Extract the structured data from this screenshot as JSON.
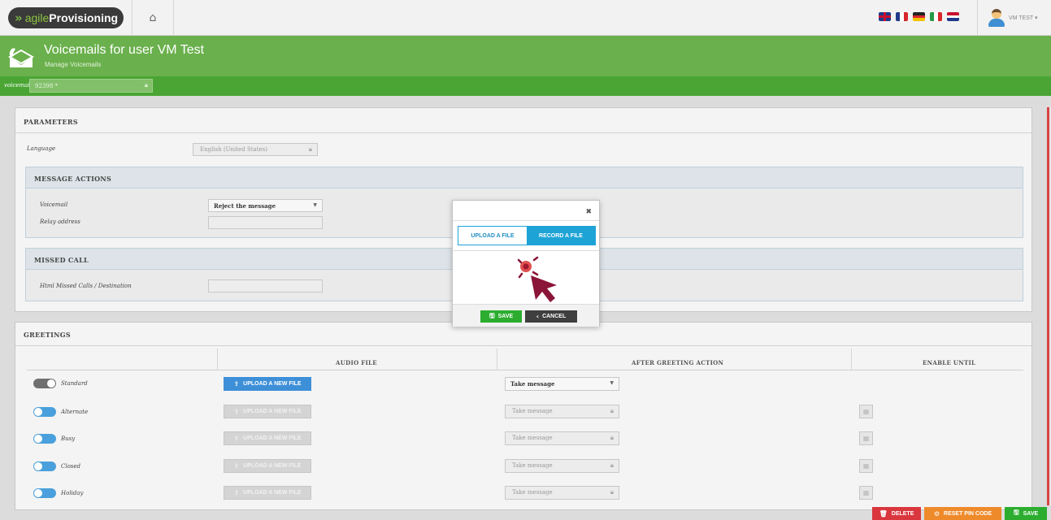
{
  "topbar": {
    "logo_light": "agile",
    "logo_bold": "Provisioning",
    "home_icon": "home-icon",
    "languages": [
      "English (UK)",
      "French",
      "German",
      "Italian",
      "Dutch"
    ],
    "user_name": "VM TEST ▾"
  },
  "header": {
    "title": "Voicemails for user VM Test",
    "subtitle": "Manage Voicemails"
  },
  "voicemail_bar": {
    "label": "voicemail",
    "value": "92398 *"
  },
  "parameters": {
    "title": "PARAMETERS",
    "language_label": "Language",
    "language_value": "English (United States)"
  },
  "message_actions": {
    "title": "MESSAGE ACTIONS",
    "voicemail_label": "Voicemail",
    "voicemail_value": "Reject the message",
    "relay_label": "Relay address",
    "relay_value": ""
  },
  "missed_call": {
    "title": "MISSED CALL",
    "label": "Html Missed Calls / Destination",
    "value": ""
  },
  "greetings": {
    "title": "GREETINGS",
    "col_audio": "AUDIO FILE",
    "col_after": "AFTER GREETING ACTION",
    "col_enable": "ENABLE UNTIL",
    "upload_label": "UPLOAD A NEW FILE",
    "rows": [
      {
        "label": "Standard",
        "action": "Take message"
      },
      {
        "label": "Alternate",
        "action": "Take message"
      },
      {
        "label": "Busy",
        "action": "Take message"
      },
      {
        "label": "Closed",
        "action": "Take message"
      },
      {
        "label": "Holiday",
        "action": "Take message"
      }
    ]
  },
  "modal": {
    "tab_upload": "UPLOAD A FILE",
    "tab_record": "RECORD A FILE",
    "save": "SAVE",
    "cancel": "CANCEL"
  },
  "footer": {
    "delete": "DELETE",
    "reset_pin": "RESET PIN CODE",
    "save": "SAVE"
  },
  "colors": {
    "header_green": "#6ab04c",
    "bar_green": "#4aa534",
    "accent_blue": "#1ea3d6",
    "delete_red": "#d9363e",
    "reset_orange": "#ee8a2a",
    "save_green": "#2cad2f",
    "cursor_maroon": "#8a1538"
  }
}
